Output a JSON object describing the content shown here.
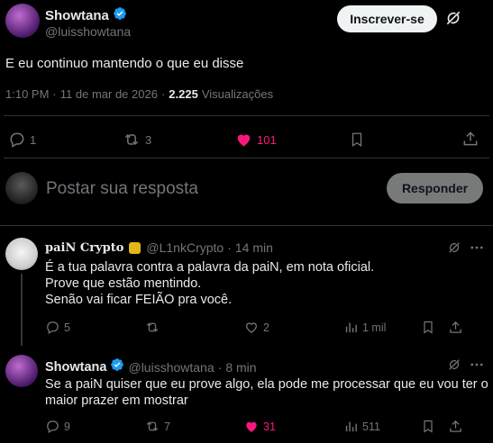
{
  "main_tweet": {
    "author_name": "Showtana",
    "author_handle": "@luisshowtana",
    "follow_label": "Inscrever-se",
    "text": "E eu continuo mantendo o que eu disse",
    "time": "1:10 PM",
    "date": "11 de mar de 2026",
    "views_count": "2.225",
    "views_label": "Visualizações",
    "stats": {
      "replies": "1",
      "retweets": "3",
      "likes": "101"
    }
  },
  "composer": {
    "placeholder": "Postar sua resposta",
    "reply_button": "Responder"
  },
  "replies": [
    {
      "author_name": "paiN Crypto",
      "author_handle": "@L1nkCrypto",
      "separator": "·",
      "time": "14 min",
      "lines": [
        "É a tua palavra contra a palavra da paiN, em nota oficial.",
        "Prove que estão mentindo.",
        "Senão vai ficar FEIÃO pra você."
      ],
      "stats": {
        "replies": "5",
        "retweets": "",
        "likes": "2",
        "views": "1 mil"
      }
    },
    {
      "author_name": "Showtana",
      "author_handle": "@luisshowtana",
      "separator": "·",
      "time": "8 min",
      "lines": [
        "Se a paiN quiser que eu prove algo, ela pode me processar que eu vou ter o",
        "maior prazer em mostrar"
      ],
      "stats": {
        "replies": "9",
        "retweets": "7",
        "likes": "31",
        "views": "511"
      }
    }
  ],
  "colors": {
    "like_pink": "#f91880",
    "verified_blue": "#1d9bf0",
    "gold_badge": "#e2b719"
  }
}
